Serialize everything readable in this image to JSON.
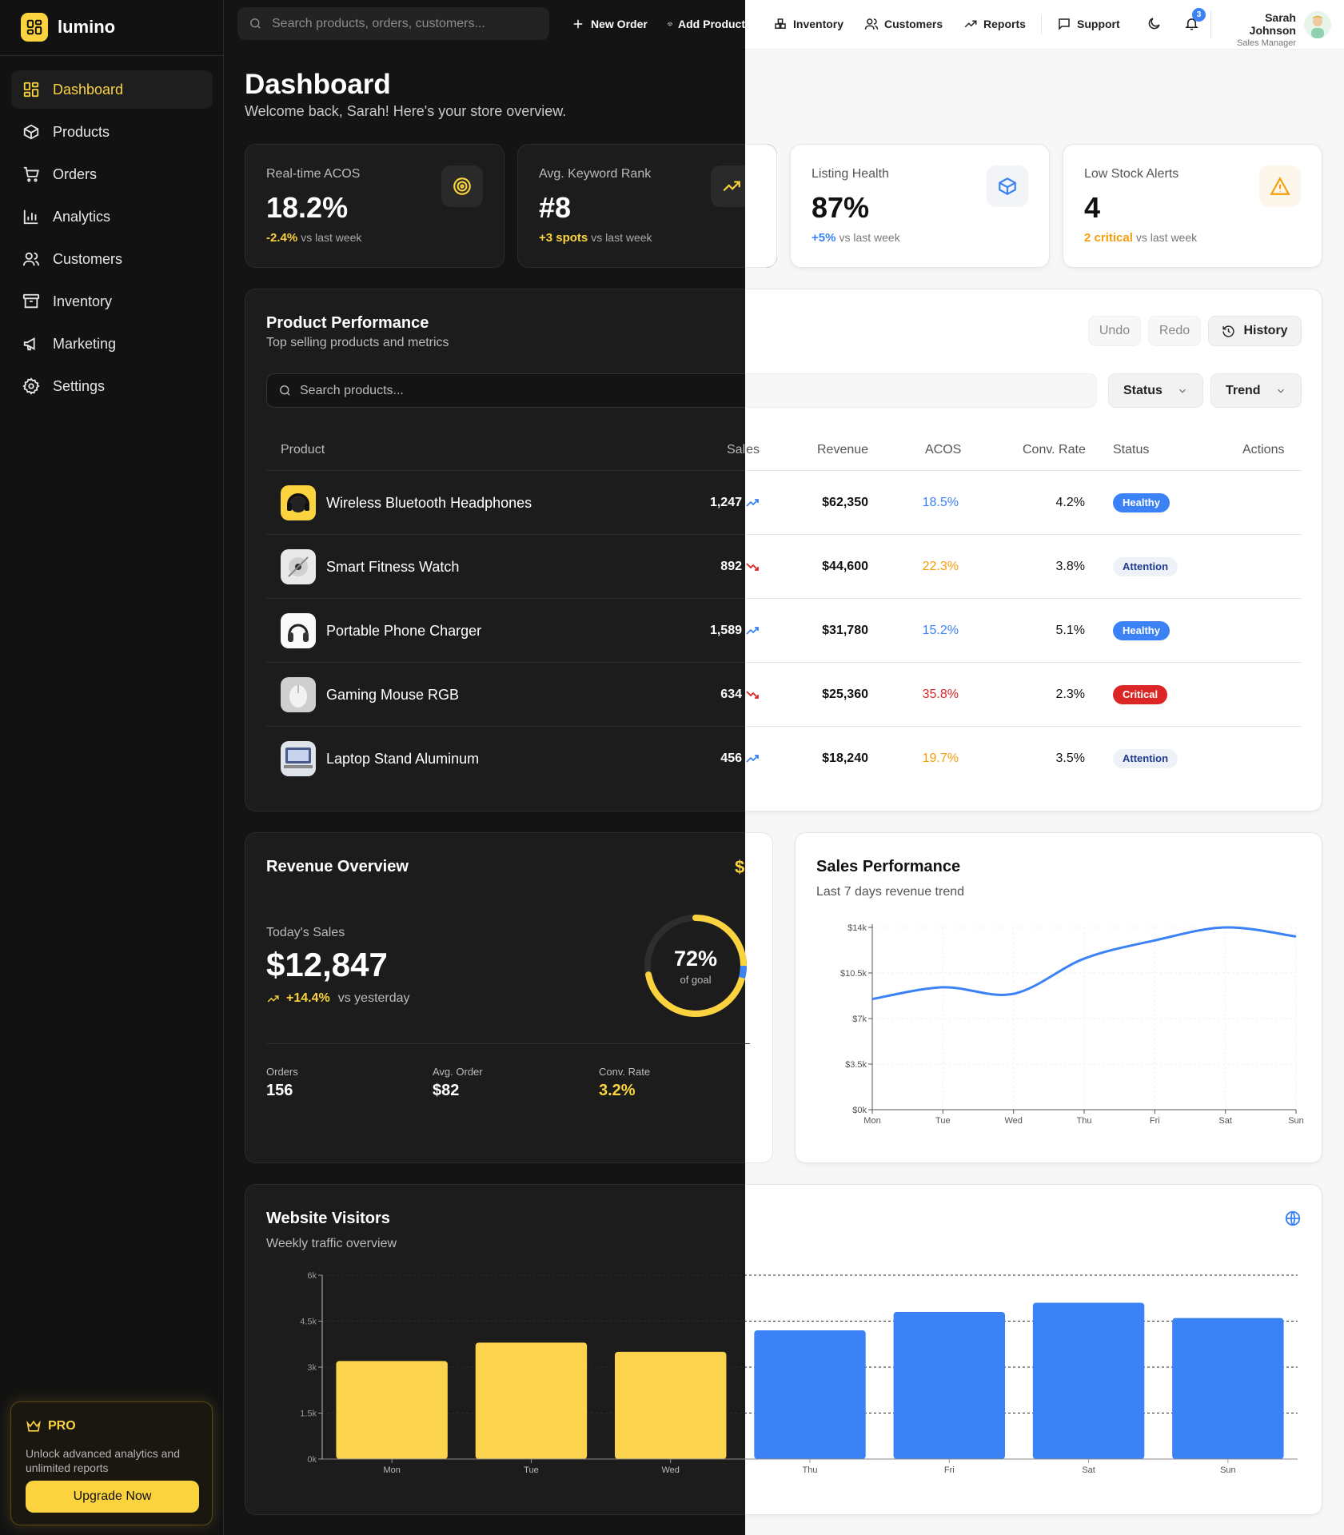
{
  "brand": {
    "name": "lumino"
  },
  "topbar": {
    "search_placeholder": "Search products, orders, customers...",
    "links": [
      "New Order",
      "Add Product",
      "Inventory",
      "Customers",
      "Reports",
      "Support"
    ],
    "notifications": "3",
    "user_name": "Sarah Johnson",
    "user_role": "Sales Manager"
  },
  "sidebar": {
    "items": [
      {
        "label": "Dashboard",
        "icon": "dashboard-icon",
        "active": true
      },
      {
        "label": "Products",
        "icon": "box-icon"
      },
      {
        "label": "Orders",
        "icon": "cart-icon"
      },
      {
        "label": "Analytics",
        "icon": "bar-chart-icon"
      },
      {
        "label": "Customers",
        "icon": "users-icon"
      },
      {
        "label": "Inventory",
        "icon": "archive-icon"
      },
      {
        "label": "Marketing",
        "icon": "megaphone-icon"
      },
      {
        "label": "Settings",
        "icon": "gear-icon"
      }
    ],
    "pro": {
      "title": "PRO",
      "text": "Unlock advanced analytics and unlimited reports",
      "button": "Upgrade Now"
    }
  },
  "header": {
    "title": "Dashboard",
    "subtitle": "Welcome back, Sarah! Here's your store overview."
  },
  "stats": [
    {
      "label": "Real-time ACOS",
      "value": "18.2%",
      "change": "-2.4%",
      "suffix": "vs last week",
      "color": "#fbd33f"
    },
    {
      "label": "Avg. Keyword Rank",
      "value": "#8",
      "change": "+3 spots",
      "suffix": "vs last week",
      "color": "#fbd33f"
    },
    {
      "label": "Listing Health",
      "value": "87%",
      "change": "+5%",
      "suffix": "vs last week",
      "color": "#3b82f6"
    },
    {
      "label": "Low Stock Alerts",
      "value": "4",
      "change": "2 critical",
      "suffix": "vs last week",
      "color": "#f59e0b"
    }
  ],
  "performance": {
    "title": "Product Performance",
    "subtitle": "Top selling products and metrics",
    "undo": "Undo",
    "redo": "Redo",
    "history": "History",
    "search_placeholder": "Search products...",
    "status_filter": "Status",
    "trend_filter": "Trend",
    "columns": [
      "Product",
      "Sales",
      "Revenue",
      "ACOS",
      "Conv. Rate",
      "Status",
      "Actions"
    ],
    "rows": [
      {
        "name": "Wireless Bluetooth Headphones",
        "sales": "1,247",
        "trend": "up",
        "revenue": "$62,350",
        "acos": "18.5%",
        "acos_color": "#3b82f6",
        "conv": "4.2%",
        "status": "Healthy"
      },
      {
        "name": "Smart Fitness Watch",
        "sales": "892",
        "trend": "down",
        "revenue": "$44,600",
        "acos": "22.3%",
        "acos_color": "#f59e0b",
        "conv": "3.8%",
        "status": "Attention"
      },
      {
        "name": "Portable Phone Charger",
        "sales": "1,589",
        "trend": "up",
        "revenue": "$31,780",
        "acos": "15.2%",
        "acos_color": "#3b82f6",
        "conv": "5.1%",
        "status": "Healthy"
      },
      {
        "name": "Gaming Mouse RGB",
        "sales": "634",
        "trend": "down",
        "revenue": "$25,360",
        "acos": "35.8%",
        "acos_color": "#dc2626",
        "conv": "2.3%",
        "status": "Critical"
      },
      {
        "name": "Laptop Stand Aluminum",
        "sales": "456",
        "trend": "up",
        "revenue": "$18,240",
        "acos": "19.7%",
        "acos_color": "#f59e0b",
        "conv": "3.5%",
        "status": "Attention"
      }
    ]
  },
  "revenue": {
    "title": "Revenue Overview",
    "today_label": "Today's Sales",
    "today_value": "$12,847",
    "change": "+14.4%",
    "change_suffix": "vs yesterday",
    "goal_percent": "72%",
    "goal_fraction": 0.72,
    "goal_label": "of goal",
    "metrics": [
      {
        "label": "Orders",
        "value": "156"
      },
      {
        "label": "Avg. Order",
        "value": "$82"
      },
      {
        "label": "Conv. Rate",
        "value": "3.2%"
      }
    ]
  },
  "chart_data": [
    {
      "type": "line",
      "title": "Sales Performance",
      "subtitle": "Last 7 days revenue trend",
      "categories": [
        "Mon",
        "Tue",
        "Wed",
        "Thu",
        "Fri",
        "Sat",
        "Sun"
      ],
      "values": [
        8500,
        9400,
        8900,
        11600,
        13000,
        14000,
        13300
      ],
      "y_ticks": [
        "$0k",
        "$3.5k",
        "$7k",
        "$10.5k",
        "$14k"
      ],
      "ylim": [
        0,
        14000
      ],
      "color": "#3b82f6"
    },
    {
      "type": "bar",
      "title": "Website Visitors",
      "subtitle": "Weekly traffic overview",
      "categories": [
        "Mon",
        "Tue",
        "Wed",
        "Thu",
        "Fri",
        "Sat",
        "Sun"
      ],
      "values": [
        3200,
        3800,
        3500,
        4200,
        4800,
        5100,
        4600
      ],
      "y_ticks": [
        "0k",
        "1.5k",
        "3k",
        "4.5k",
        "6k"
      ],
      "ylim": [
        0,
        6000
      ],
      "colors": {
        "dark": "#fcd34d",
        "light": "#3b82f6"
      }
    }
  ]
}
